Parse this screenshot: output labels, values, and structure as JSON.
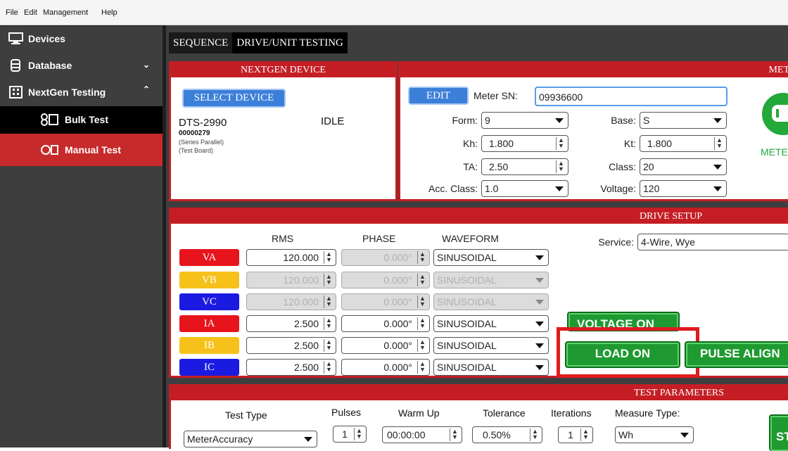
{
  "menubar": {
    "file": "File",
    "edit": "Edit",
    "management": "Management",
    "help": "Help"
  },
  "sidebar": {
    "devices": "Devices",
    "database": "Database",
    "nextgen_testing": "NextGen Testing",
    "bulk_test": "Bulk Test",
    "manual_test": "Manual Test"
  },
  "tabs": {
    "sequence": "SEQUENCE",
    "drive_unit_testing": "DRIVE/UNIT TESTING"
  },
  "nextgen_device": {
    "title": "NEXTGEN DEVICE",
    "select_device": "SELECT DEVICE",
    "model": "DTS-2990",
    "status": "IDLE",
    "serial": "00000279",
    "mode": "(Series Parallel)",
    "board": "(Test Board)"
  },
  "meter": {
    "title": "MET",
    "edit": "EDIT",
    "sn_label": "Meter SN:",
    "sn_value": "09936600",
    "form_label": "Form:",
    "form_value": "9",
    "base_label": "Base:",
    "base_value": "S",
    "kh_label": "Kh:",
    "kh_value": "1.800",
    "kt_label": "Kt:",
    "kt_value": "1.800",
    "ta_label": "TA:",
    "ta_value": "2.50",
    "class_label": "Class:",
    "class_value": "20",
    "acc_class_label": "Acc. Class:",
    "acc_class_value": "1.0",
    "voltage_label": "Voltage:",
    "voltage_value": "120",
    "status": "METER I"
  },
  "drive_setup": {
    "title": "DRIVE SETUP",
    "col_rms": "RMS",
    "col_phase": "PHASE",
    "col_waveform": "WAVEFORM",
    "service_label": "Service:",
    "service_value": "4-Wire, Wye",
    "rows": [
      {
        "label": "VA",
        "color": "#e8141b",
        "rms": "120.000",
        "phase": "0.000°",
        "waveform": "SINUSOIDAL"
      },
      {
        "label": "VB",
        "color": "#f6c11a",
        "rms": "120.000",
        "phase": "0.000°",
        "waveform": "SINUSOIDAL"
      },
      {
        "label": "VC",
        "color": "#1a1ae0",
        "rms": "120.000",
        "phase": "0.000°",
        "waveform": "SINUSOIDAL"
      },
      {
        "label": "IA",
        "color": "#e8141b",
        "rms": "2.500",
        "phase": "0.000°",
        "waveform": "SINUSOIDAL"
      },
      {
        "label": "IB",
        "color": "#f6c11a",
        "rms": "2.500",
        "phase": "0.000°",
        "waveform": "SINUSOIDAL"
      },
      {
        "label": "IC",
        "color": "#1a1ae0",
        "rms": "2.500",
        "phase": "0.000°",
        "waveform": "SINUSOIDAL"
      }
    ],
    "voltage_on": "VOLTAGE ON",
    "load_on": "LOAD ON",
    "pulse_align": "PULSE ALIGN"
  },
  "test_parameters": {
    "title": "TEST PARAMETERS",
    "test_type_label": "Test Type",
    "test_type_value": "MeterAccuracy",
    "pulses_label": "Pulses",
    "pulses_value": "1",
    "warmup_label": "Warm Up",
    "warmup_value": "00:00:00",
    "tolerance_label": "Tolerance",
    "tolerance_value": "0.50%",
    "iterations_label": "Iterations",
    "iterations_value": "1",
    "measure_type_label": "Measure Type:",
    "measure_type_value": "Wh",
    "start": "ST"
  }
}
